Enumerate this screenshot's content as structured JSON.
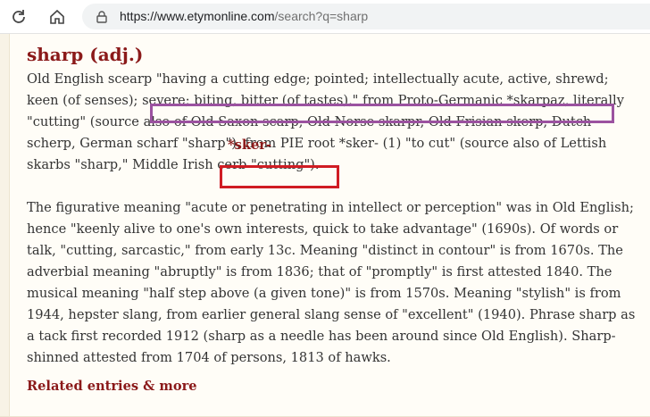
{
  "browser": {
    "url_host": "https://www.etymonline.com",
    "url_path": "/search?q=sharp"
  },
  "entry": {
    "headword": "sharp (adj.)",
    "paragraph1": "Old English scearp \"having a cutting edge; pointed; intellectually acute, active, shrewd; keen (of senses); severe; biting, bitter (of tastes),\" from Proto-Germanic *skarpaz, literally \"cutting\" (source also of Old Saxon scarp, Old Norse skarpr, Old Frisian skerp, Dutch scherp, German scharf \"sharp\"), from PIE root *sker- (1) \"to cut\" (source also of Lettish skarbs \"sharp,\" Middle Irish cerb \"cutting\").",
    "root_link": "*sker-",
    "paragraph2": "The figurative meaning \"acute or penetrating in intellect or perception\" was in Old English; hence \"keenly alive to one's own interests, quick to take advantage\" (1690s). Of words or talk, \"cutting, sarcastic,\" from early 13c. Meaning \"distinct in contour\" is from 1670s. The adverbial meaning \"abruptly\" is from 1836; that of \"promptly\" is first attested 1840. The musical meaning \"half step above (a given tone)\" is from 1570s. Meaning \"stylish\" is from 1944, hepster slang, from earlier general slang sense of \"excellent\" (1940). Phrase sharp as a tack first recorded 1912 (sharp as a needle has been around since Old English). Sharp-shinned attested from 1704 of persons, 1813 of hawks.",
    "related_label": "Related entries & more"
  },
  "colors": {
    "headword": "#8b1a1a",
    "highlight_purple": "#9b52a0",
    "highlight_red": "#d01c24"
  }
}
